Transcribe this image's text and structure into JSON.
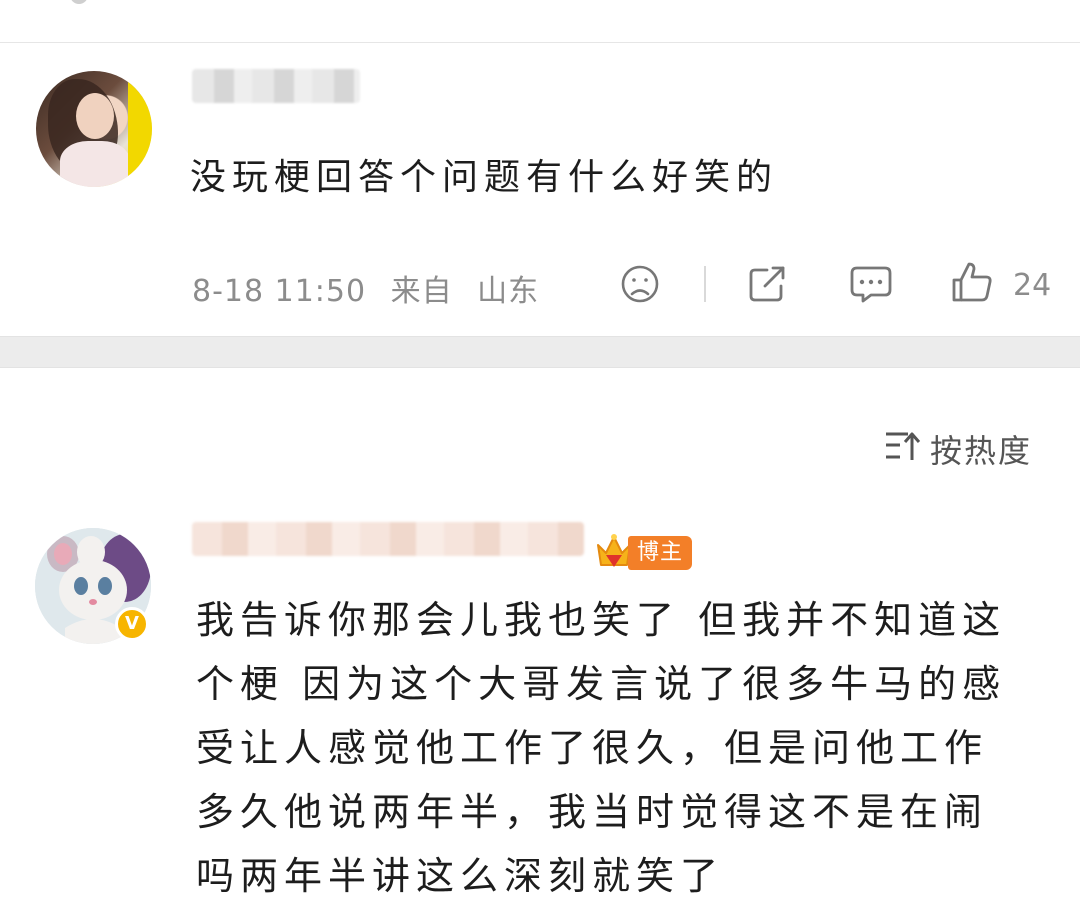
{
  "comments": [
    {
      "text": "没玩梗回答个问题有什么好笑的",
      "date": "8-18 11:50",
      "from_label": "来自",
      "location": "山东",
      "like_count": "24"
    },
    {
      "badge_label": "博主",
      "verified_badge": "V",
      "text_lines": [
        "我告诉你那会儿我也笑了 但我并不知道这",
        "个梗 因为这个大哥发言说了很多牛马的感",
        "受让人感觉他工作了很久，但是问他工作",
        "多久他说两年半，我当时觉得这不是在闹",
        "吗两年半讲这么深刻就笑了"
      ]
    }
  ],
  "sort": {
    "label": "按热度"
  },
  "icons": {
    "dislike": "sad-face-icon",
    "share": "share-icon",
    "comment": "comment-icon",
    "like": "thumbs-up-icon",
    "sort": "sort-icon",
    "crown": "crown-icon"
  },
  "colors": {
    "badge": "#f37f28",
    "verified": "#f7b500",
    "meta_text": "#8c8c8c",
    "divider": "#ececec"
  }
}
